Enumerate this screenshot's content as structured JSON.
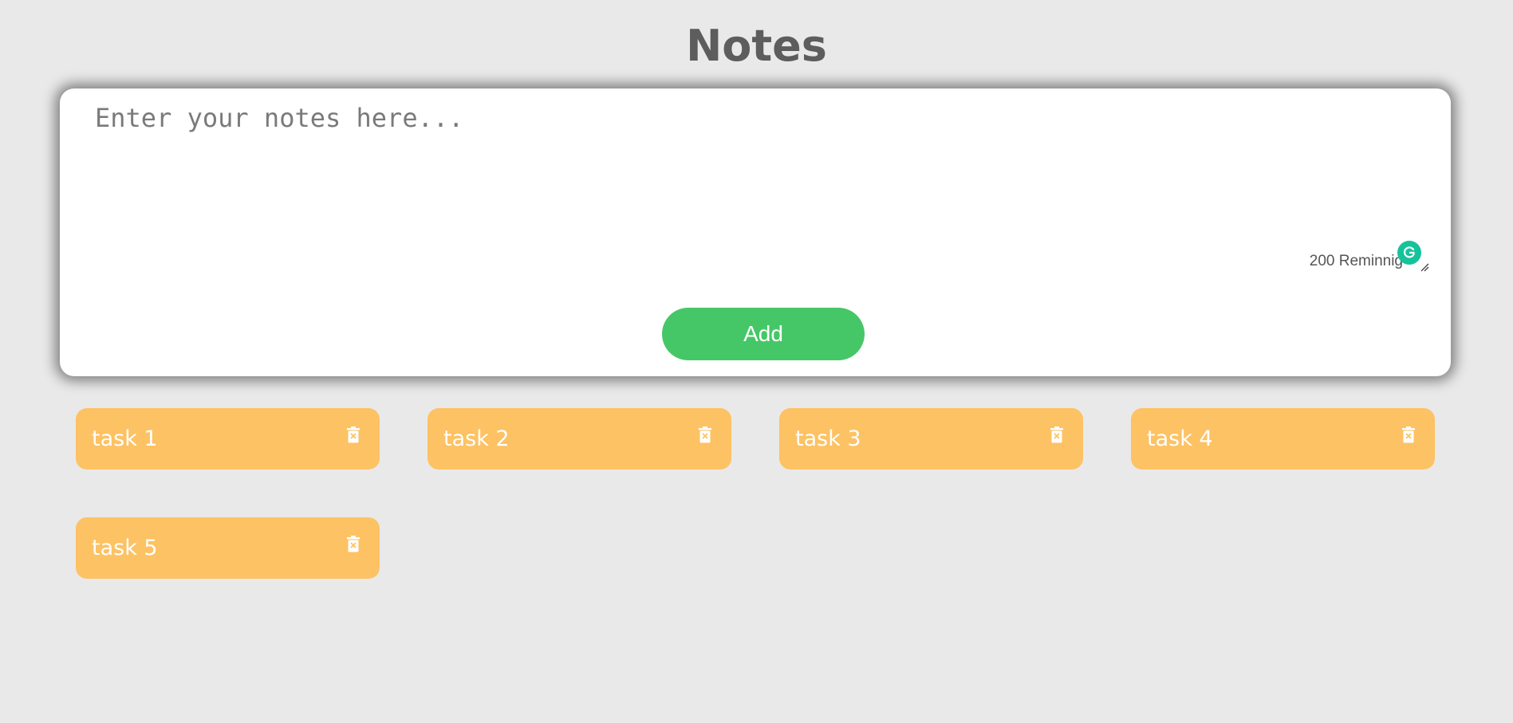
{
  "header": {
    "title": "Notes"
  },
  "editor": {
    "placeholder": "Enter your notes here...",
    "value": "",
    "remaining_text": "200 Reminnig",
    "add_label": "Add"
  },
  "tasks": [
    {
      "label": "task 1"
    },
    {
      "label": "task 2"
    },
    {
      "label": "task 3"
    },
    {
      "label": "task 4"
    },
    {
      "label": "task 5"
    }
  ],
  "icons": {
    "grammar": "grammarly-icon",
    "resize": "resize-handle-icon",
    "delete": "trash-icon"
  },
  "colors": {
    "background": "#e9e9e9",
    "add_button": "#46c767",
    "task_card": "#fdc263",
    "grammar_badge": "#15c39a",
    "title": "#5d5d5d"
  }
}
